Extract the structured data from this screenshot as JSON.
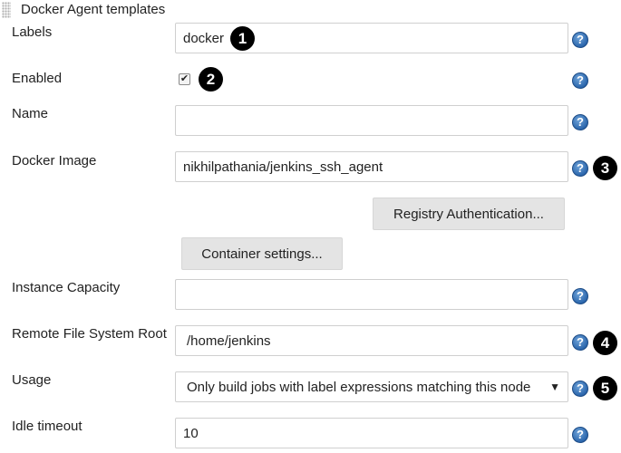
{
  "section": {
    "title": "Docker Agent templates"
  },
  "fields": {
    "labels": {
      "label": "Labels",
      "value": "docker"
    },
    "enabled": {
      "label": "Enabled",
      "checked": true
    },
    "name": {
      "label": "Name",
      "value": ""
    },
    "docker_image": {
      "label": "Docker Image",
      "value": "nikhilpathania/jenkins_ssh_agent"
    },
    "instance_capacity": {
      "label": "Instance Capacity",
      "value": ""
    },
    "remote_fs_root": {
      "label": "Remote File System Root",
      "value": "/home/jenkins"
    },
    "usage": {
      "label": "Usage",
      "value": "Only build jobs with label expressions matching this node"
    },
    "idle_timeout": {
      "label": "Idle timeout",
      "value": "10"
    }
  },
  "buttons": {
    "registry_auth": "Registry Authentication...",
    "container_settings": "Container settings..."
  },
  "help_icon": "?",
  "callouts": [
    "1",
    "2",
    "3",
    "4",
    "5"
  ],
  "colors": {
    "help_blue": "#2c67ad",
    "button_gray": "#e4e4e4",
    "callout_black": "#000000"
  }
}
